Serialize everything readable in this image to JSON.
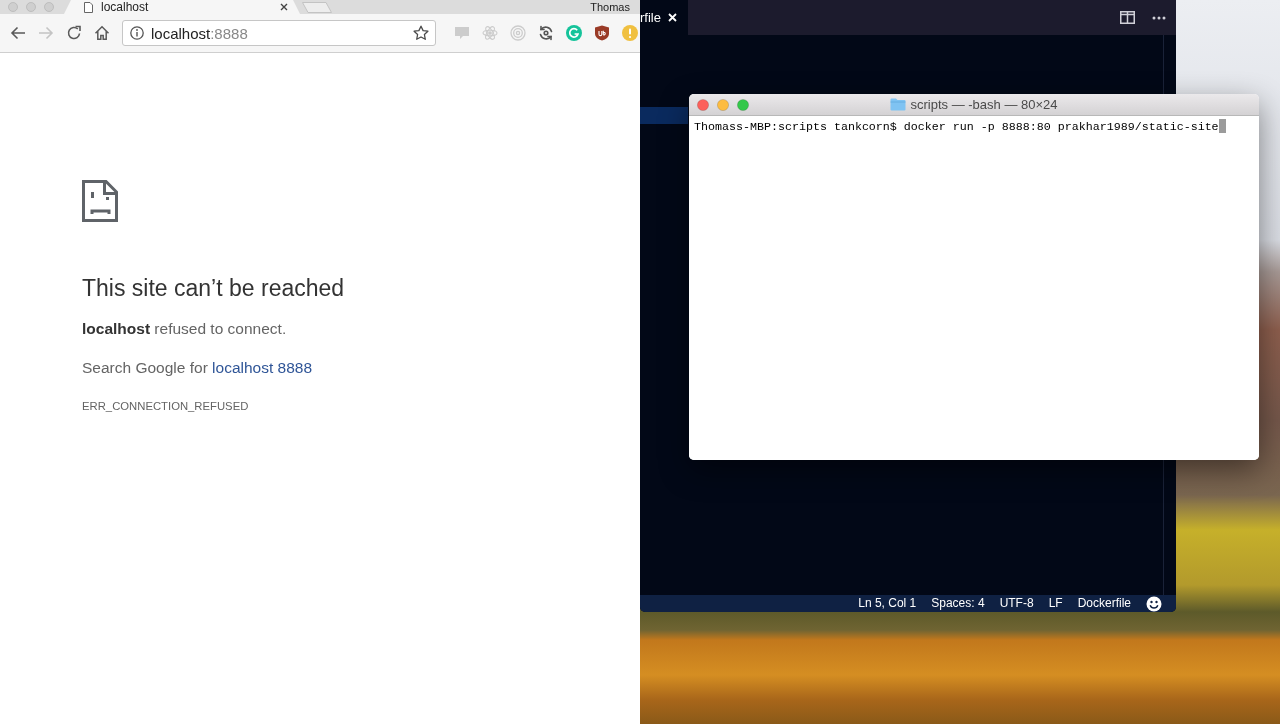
{
  "browser": {
    "tabs": [
      {
        "title": "localhost",
        "selected": true
      }
    ],
    "profile_name": "Thomas",
    "navigation": {
      "back_disabled": false,
      "forward_disabled": true
    },
    "address_bar": {
      "host": "localhost",
      "port": ":8888",
      "bookmarked": false
    },
    "extensions": [
      {
        "kind": "css",
        "disabled": true
      },
      {
        "kind": "atom",
        "disabled": true
      },
      {
        "kind": "target",
        "disabled": true
      },
      {
        "kind": "sync",
        "disabled": false
      },
      {
        "kind": "grammar",
        "disabled": false
      },
      {
        "kind": "shield",
        "disabled": false
      },
      {
        "kind": "alert",
        "disabled": false
      }
    ],
    "error_page": {
      "heading": "This site can’t be reached",
      "message": "**localhost** refused to connect.",
      "suggestion": "Search Google for",
      "suggestion_link": "localhost 8888",
      "error_code": "ERR_CONNECTION_REFUSED"
    }
  },
  "editor": {
    "tabs": [
      {
        "title": "rfile",
        "selected": true
      }
    ],
    "status_bar": [
      "Ln 5, Col 1",
      "Spaces: 4",
      "UTF-8",
      "LF",
      "Dockerfile"
    ]
  },
  "terminal": {
    "title": "scripts — -bash — 80×24",
    "lines": [
      "Thomass-MBP:scripts tankcorn$ docker run -p 8888:80 prakhar1989/static-site"
    ]
  }
}
